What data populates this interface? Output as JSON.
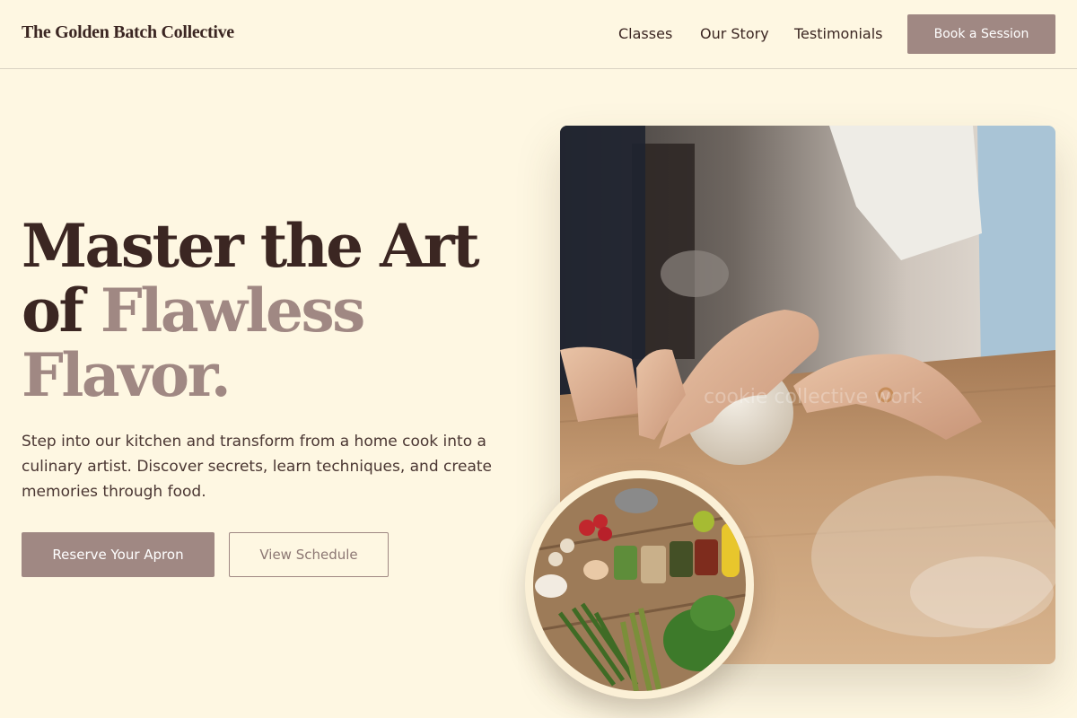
{
  "header": {
    "brand": "The Golden Batch Collective",
    "nav": [
      "Classes",
      "Our Story",
      "Testimonials"
    ],
    "cta": "Book a Session"
  },
  "hero": {
    "headline_line1": "Master the Art",
    "headline_line2_prefix": "of ",
    "headline_line2_accent": "Flawless",
    "headline_line3": "Flavor.",
    "intro": "Step into our kitchen and transform from a home cook into a culinary artist. Discover secrets, learn techniques, and create memories through food.",
    "primary_button": "Reserve Your Apron",
    "secondary_button": "View Schedule"
  },
  "images": {
    "main_photo": "Hands kneading dough on a wooden counter",
    "circle_photo": "Fresh vegetables and spice jars on a wooden table",
    "watermark": "cookie collective work"
  },
  "colors": {
    "background": "#fef7e2",
    "accent": "#a08883",
    "text": "#3b2622"
  }
}
